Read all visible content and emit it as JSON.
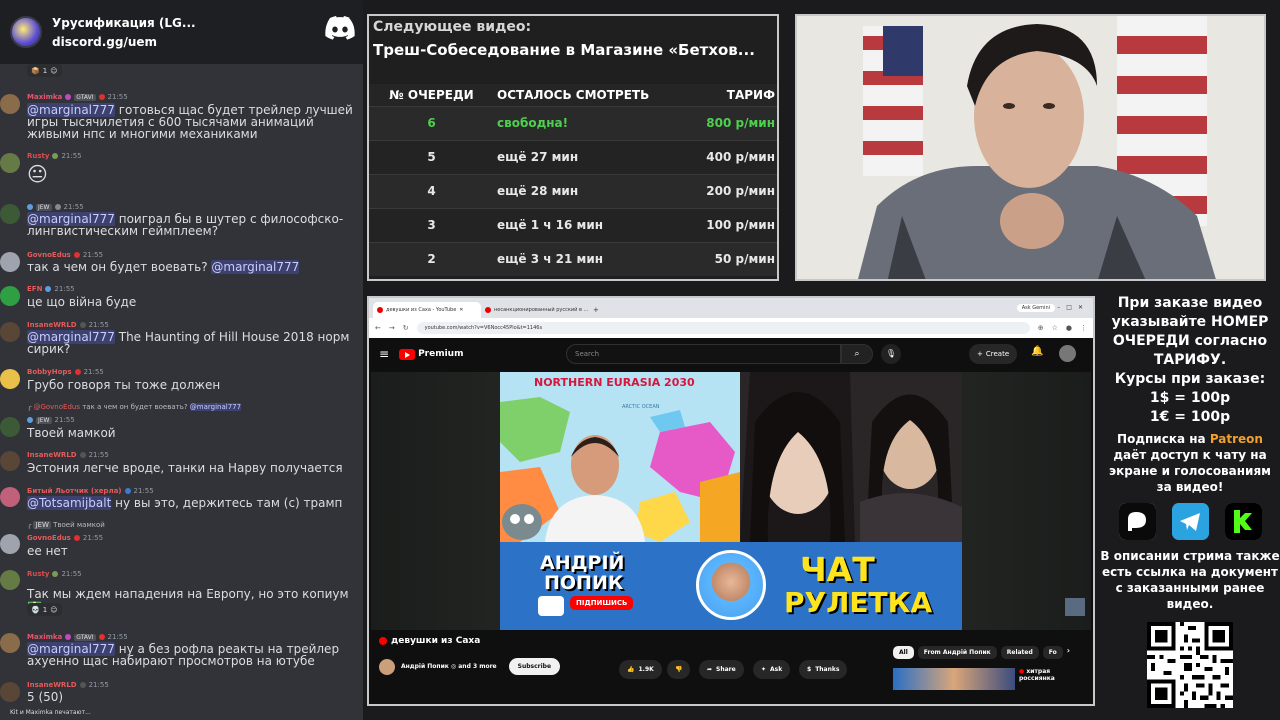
{
  "discord": {
    "server_name": "Урусификация (LG...",
    "server_link": "discord.gg/uem",
    "top_reaction_count": "1",
    "typing": "Kit и Maximka печатают...",
    "messages": [
      {
        "author": "Maximka",
        "tag": "GTAVI",
        "time": "21:55",
        "mention": "@marginal777",
        "text": " готовься щас будет трейлер лучшей игры тысячилетия с 600 тысячами анимаций живыми нпс и многими механиками"
      },
      {
        "author": "Rusty",
        "time": "21:55",
        "emoji": "😐"
      },
      {
        "author": "",
        "tag": "JEW",
        "time": "21:55",
        "mention": "@marginal777",
        "text": " поиграл бы в шутер с философско-лингвистическим геймплеем?"
      },
      {
        "author": "GovnoEdus",
        "time": "21:55",
        "text": "так а чем он будет воевать? ",
        "mention_after": "@marginal777"
      },
      {
        "author": "EFN",
        "time": "21:55",
        "text": "це що війна буде"
      },
      {
        "author": "InsaneWRLD",
        "time": "21:55",
        "mention": "@marginal777",
        "text": " The Haunting of Hill House 2018 норм сирик?"
      },
      {
        "author": "BobbyHops",
        "time": "21:55",
        "text": "Грубо говоря ты тоже должен"
      },
      {
        "reply_author": "@GovnoEdus",
        "reply_text": "так а чем он будет воевать?",
        "reply_mention": "@marginal777",
        "tag": "JEW",
        "time": "21:55",
        "text": "Твоей мамкой"
      },
      {
        "author": "InsaneWRLD",
        "time": "21:55",
        "text": "Эстония легче вроде, танки на Нарву получается"
      },
      {
        "author": "Битый Льотчик (херла)",
        "time": "21:55",
        "mention": "@Totsamijbalt",
        "text": " ну вы это, держитесь там (с) трамп"
      },
      {
        "reply_tag": "JEW",
        "reply_text": "Твоей мамкой",
        "author": "GovnoEdus",
        "time": "21:55",
        "text": "ее нет"
      },
      {
        "author": "Rusty",
        "time": "21:55",
        "text": "Так мы ждем нападения на Европу, но это копиум",
        "reaction_count": "1"
      },
      {
        "author": "Maximka",
        "tag": "GTAVI",
        "time": "21:55",
        "mention": "@marginal777",
        "text": " ну а без рофла реакты на трейлер ахуенно щас набирают просмотров на ютубе"
      },
      {
        "author": "InsaneWRLD",
        "time": "21:55",
        "text": "5 (50)"
      }
    ]
  },
  "queue": {
    "label": "Следующее видео:",
    "title": "Треш-Собеседование в Магазине «Бетхов...",
    "headers": [
      "№ ОЧЕРЕДИ",
      "ОСТАЛОСЬ СМОТРЕТЬ",
      "ТАРИФ"
    ],
    "rows": [
      [
        "6",
        "свободна!",
        "800 р/мин"
      ],
      [
        "5",
        "ещё 27 мин",
        "400 р/мин"
      ],
      [
        "4",
        "ещё 28 мин",
        "200 р/мин"
      ],
      [
        "3",
        "ещё 1 ч 16 мин",
        "100 р/мин"
      ],
      [
        "2",
        "ещё 3 ч 21 мин",
        "50 р/мин"
      ]
    ]
  },
  "browser": {
    "tab1": "девушки из Саха - YouTube",
    "tab2": "несанкционированный русский в ...",
    "ask_gemini": "Ask Gemini",
    "url": "youtube.com/watch?v=V6Nocc45Plo&t=1146s",
    "search_placeholder": "Search",
    "logo_text": "Premium",
    "create_label": "Create"
  },
  "video": {
    "map_title": "NORTHERN EURASIA 2030",
    "map_ocean": "ARCTIC OCEAN",
    "banner_name_line1": "АНДРІЙ",
    "banner_name_line2": "ПОПИК",
    "subscribe_badge": "ПІДПИШИСЬ",
    "chat_label": "ЧАТ",
    "roulette_label": "РУЛЕТКА",
    "title": "девушки из Саха",
    "channel": "Андрій Попик ◎ and 3 more",
    "subscribe": "Subscribe",
    "likes": "1.9K",
    "share": "Share",
    "ask": "Ask",
    "thanks": "Thanks",
    "chips": [
      "All",
      "From Андрій Попик",
      "Related",
      "Fo"
    ],
    "rec_text": "хитрая россиянка"
  },
  "info": {
    "order_text": "При заказе видео указывайте НОМЕР ОЧЕРЕДИ согласно ТАРИФУ.",
    "rates_title": "Курсы при заказе:",
    "rate_usd": "1$ = 100р",
    "rate_eur": "1€ = 100р",
    "patreon_pre": "Подписка на ",
    "patreon_name": "Patreon",
    "patreon_post": " даёт доступ к чату на экране и голосованиям за видео!",
    "description_note": "В описании стрима также есть ссылка на документ с заказанными ранее видео."
  },
  "colors": {
    "free_green": "#4fcf4f",
    "patreon_orange": "#f0a030",
    "discord_bg": "#313338"
  }
}
